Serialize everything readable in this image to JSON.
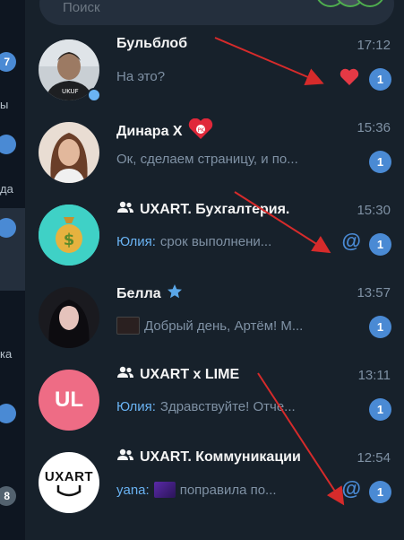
{
  "search": {
    "placeholder": "Поиск"
  },
  "rail": {
    "badges": [
      "7",
      "",
      "",
      "",
      "8"
    ],
    "labels": [
      "ы",
      "да",
      "ка"
    ]
  },
  "chats": [
    {
      "name": "Бульблоб",
      "time": "17:12",
      "sender": "",
      "preview": "На это?",
      "unread": "1",
      "avatar_text": ""
    },
    {
      "name": "Динара Х",
      "time": "15:36",
      "sender": "",
      "preview": "Ок, сделаем страницу, и по...",
      "unread": "1",
      "avatar_text": ""
    },
    {
      "name": "UXART. Бухгалтерия.",
      "time": "15:30",
      "sender": "Юлия:",
      "preview": "срок выполнени...",
      "unread": "1",
      "avatar_text": "$"
    },
    {
      "name": "Белла",
      "time": "13:57",
      "sender": "",
      "preview": "Добрый день, Артём! М...",
      "unread": "1",
      "avatar_text": ""
    },
    {
      "name": "UXART x LIME",
      "time": "13:11",
      "sender": "Юлия:",
      "preview": "Здравствуйте!  Отче...",
      "unread": "1",
      "avatar_text": "UL"
    },
    {
      "name": "UXART. Коммуникации",
      "time": "12:54",
      "sender": "yana:",
      "preview": "поправила по...",
      "unread": "1",
      "avatar_text": "UXART"
    }
  ],
  "colors": {
    "accent": "#4a8ad4",
    "background": "#17212b",
    "arrow": "#d62b2b"
  }
}
